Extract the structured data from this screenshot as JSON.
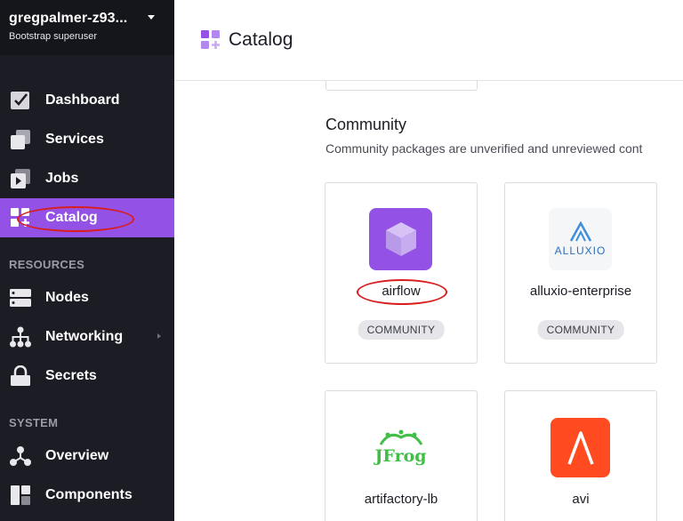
{
  "sidebar": {
    "user_name": "gregpalmer-z93...",
    "user_role": "Bootstrap superuser",
    "items_main": [
      {
        "label": "Dashboard",
        "icon": "dashboard-icon"
      },
      {
        "label": "Services",
        "icon": "services-icon"
      },
      {
        "label": "Jobs",
        "icon": "jobs-icon"
      },
      {
        "label": "Catalog",
        "icon": "catalog-icon",
        "active": true
      }
    ],
    "section_resources": "RESOURCES",
    "items_resources": [
      {
        "label": "Nodes",
        "icon": "nodes-icon"
      },
      {
        "label": "Networking",
        "icon": "networking-icon"
      },
      {
        "label": "Secrets",
        "icon": "lock-icon"
      }
    ],
    "section_system": "SYSTEM",
    "items_system": [
      {
        "label": "Overview",
        "icon": "overview-icon"
      },
      {
        "label": "Components",
        "icon": "components-icon"
      }
    ]
  },
  "header": {
    "title": "Catalog"
  },
  "community": {
    "title": "Community",
    "description": "Community packages are unverified and unreviewed cont",
    "packages": [
      {
        "name": "airflow",
        "badge": "COMMUNITY",
        "logo": "airflow-cube-icon"
      },
      {
        "name": "alluxio-enterprise",
        "badge": "COMMUNITY",
        "logo": "alluxio-logo",
        "logo_text": "ALLUXIO"
      },
      {
        "name": "artifactory-lb",
        "logo": "jfrog-logo",
        "logo_text": "JFrog"
      },
      {
        "name": "avi",
        "logo": "avi-logo"
      }
    ]
  },
  "colors": {
    "accent": "#9351e5",
    "sidebar_bg": "#1b1c24",
    "annotation": "#d81e1e"
  }
}
